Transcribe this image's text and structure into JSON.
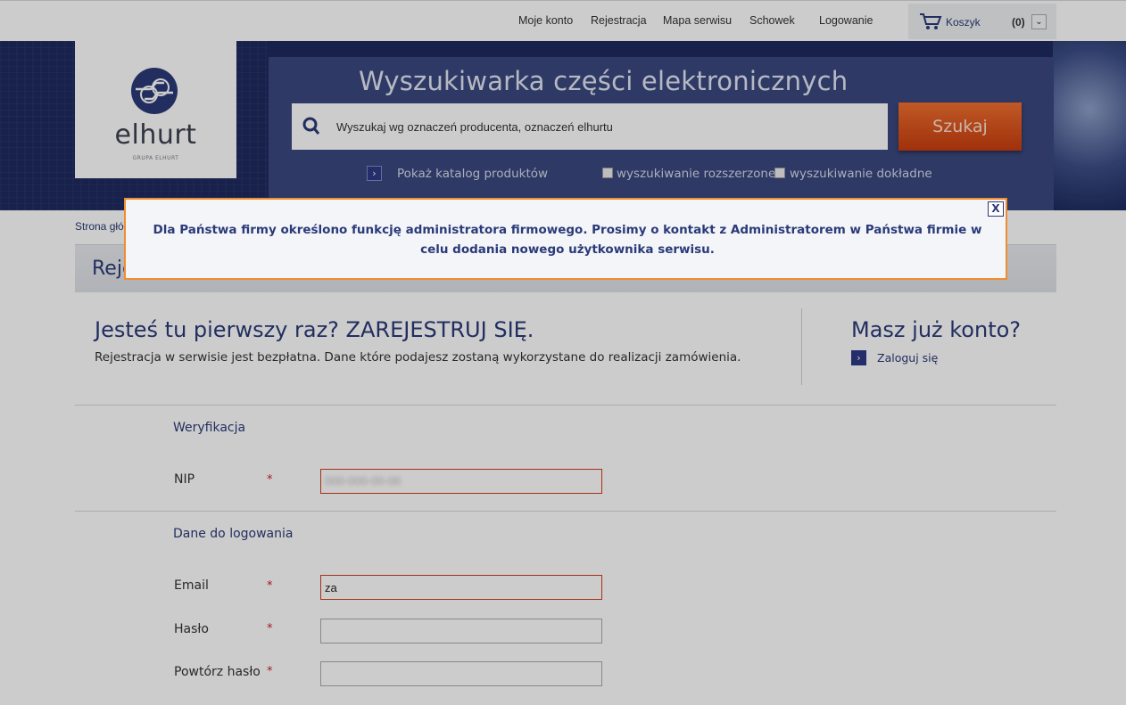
{
  "topnav": {
    "links": [
      "Moje konto",
      "Rejestracja",
      "Mapa serwisu",
      "Schowek",
      "Logowanie"
    ],
    "cart_label": "Koszyk",
    "cart_count": "(0)"
  },
  "logo": {
    "name": "elhurt",
    "subtitle": "GRUPA ELHURT"
  },
  "search": {
    "title": "Wyszukiwarka części elektronicznych",
    "placeholder": "Wyszukaj wg oznaczeń producenta, oznaczeń elhurtu",
    "button": "Szukaj",
    "catalog_link": "Pokaż katalog produktów",
    "option_extended": "wyszukiwanie rozszerzone",
    "option_exact": "wyszukiwanie dokładne"
  },
  "breadcrumb": "Strona głó",
  "page_title": "Reje",
  "register": {
    "title": "Jesteś tu pierwszy raz? ZAREJESTRUJ SIĘ.",
    "description": "Rejestracja w serwisie jest bezpłatna. Dane które podajesz zostaną wykorzystane do realizacji zamówienia."
  },
  "login": {
    "title": "Masz już konto?",
    "link": "Zaloguj się"
  },
  "form": {
    "section_verification": "Weryfikacja",
    "nip_label": "NIP",
    "nip_value": "000-000-00-00",
    "section_login": "Dane do logowania",
    "email_label": "Email",
    "email_value": "za",
    "password_label": "Hasło",
    "password_repeat_label": "Powtórz hasło",
    "required_mark": "*"
  },
  "modal": {
    "close": "X",
    "message": "Dla Państwa firmy określono funkcję administratora firmowego. Prosimy o kontakt z Administratorem w Państwa firmie w celu dodania nowego użytkownika serwisu."
  },
  "colors": {
    "accent": "#2b3a78",
    "button": "#e0561f",
    "modal_border": "#f08d2e"
  }
}
